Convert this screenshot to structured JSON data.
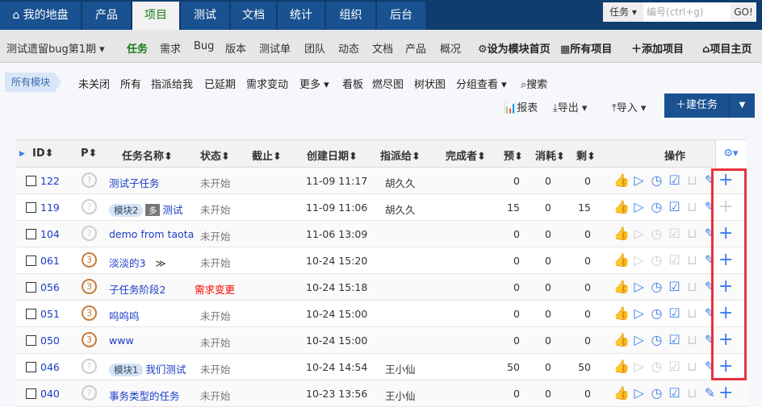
{
  "topnav": {
    "tabs": [
      "我的地盘",
      "产品",
      "项目",
      "测试",
      "文档",
      "统计",
      "组织",
      "后台"
    ],
    "active": 2,
    "search_type": "任务",
    "search_placeholder": "编号(ctrl+g)",
    "go": "GO!"
  },
  "subnav": {
    "project": "测试遗留bug第1期",
    "items": [
      "任务",
      "需求",
      "Bug",
      "版本",
      "测试单",
      "团队",
      "动态",
      "文档",
      "产品",
      "概况"
    ],
    "active": 0,
    "set_home": "设为模块首页",
    "all_projects": "所有项目",
    "add_project": "添加项目",
    "project_home": "项目主页"
  },
  "filter": {
    "module": "所有模块",
    "items": [
      "未关闭",
      "所有",
      "指派给我",
      "已延期",
      "需求变动",
      "更多",
      "看板",
      "燃尽图",
      "树状图",
      "分组查看",
      "搜索"
    ]
  },
  "tools": {
    "report": "报表",
    "export": "导出",
    "import": "导入",
    "new_task": "建任务"
  },
  "table": {
    "headers": {
      "id": "ID",
      "pri": "P",
      "name": "任务名称",
      "status": "状态",
      "deadline": "截止",
      "created": "创建日期",
      "assigned": "指派给",
      "finisher": "完成者",
      "estimate": "预",
      "consumed": "消耗",
      "left": "剩",
      "actions": "操作"
    },
    "rows": [
      {
        "id": "122",
        "pri": "?",
        "tags": [],
        "multi": "",
        "name": "测试子任务",
        "status": "未开始",
        "created": "11-09 11:17",
        "assigned": "胡久久",
        "est": "0",
        "con": "0",
        "left": "0",
        "enabled": true,
        "plus": true
      },
      {
        "id": "119",
        "pri": "?",
        "tags": [
          "模块2"
        ],
        "multi": "多",
        "name": "测试",
        "status": "未开始",
        "created": "11-09 11:06",
        "assigned": "胡久久",
        "est": "15",
        "con": "0",
        "left": "15",
        "enabled": true,
        "plus": false
      },
      {
        "id": "104",
        "pri": "?",
        "tags": [],
        "multi": "",
        "name": "demo from taotao",
        "status": "未开始",
        "created": "11-06 13:09",
        "assigned": "",
        "est": "0",
        "con": "0",
        "left": "0",
        "enabled": false,
        "plus": true
      },
      {
        "id": "061",
        "pri": "3",
        "tags": [],
        "multi": "",
        "name": "淡淡的3",
        "expand": "≫",
        "status": "未开始",
        "created": "10-24 15:20",
        "assigned": "",
        "est": "0",
        "con": "0",
        "left": "0",
        "enabled": false,
        "plus": true
      },
      {
        "id": "056",
        "pri": "3",
        "tags": [],
        "multi": "",
        "name": "子任务阶段2",
        "status": "需求变更",
        "status_color": "#ff0000",
        "created": "10-24 15:18",
        "assigned": "",
        "est": "0",
        "con": "0",
        "left": "0",
        "enabled": true,
        "plus": true
      },
      {
        "id": "051",
        "pri": "3",
        "tags": [],
        "multi": "",
        "name": "呜呜呜",
        "status": "未开始",
        "created": "10-24 15:00",
        "assigned": "",
        "est": "0",
        "con": "0",
        "left": "0",
        "enabled": true,
        "plus": true
      },
      {
        "id": "050",
        "pri": "3",
        "tags": [],
        "multi": "",
        "name": "www",
        "status": "未开始",
        "created": "10-24 15:00",
        "assigned": "",
        "est": "0",
        "con": "0",
        "left": "0",
        "enabled": true,
        "plus": true
      },
      {
        "id": "046",
        "pri": "?",
        "tags": [
          "模块1"
        ],
        "multi": "",
        "name": "我们测试",
        "status": "未开始",
        "created": "10-24 14:54",
        "assigned": "王小仙",
        "est": "50",
        "con": "0",
        "left": "50",
        "enabled": false,
        "plus": true
      },
      {
        "id": "040",
        "pri": "?",
        "tags": [],
        "multi": "",
        "name": "事务类型的任务",
        "status": "未开始",
        "created": "10-23 13:56",
        "assigned": "王小仙",
        "est": "0",
        "con": "0",
        "left": "0",
        "enabled": true,
        "plus": true
      }
    ]
  },
  "colors": {
    "nav": "#0f3d6e",
    "tab": "#1a5190",
    "link": "#1a3cc8",
    "icon": "#3b7ce8",
    "highlight": "#e8323c"
  }
}
